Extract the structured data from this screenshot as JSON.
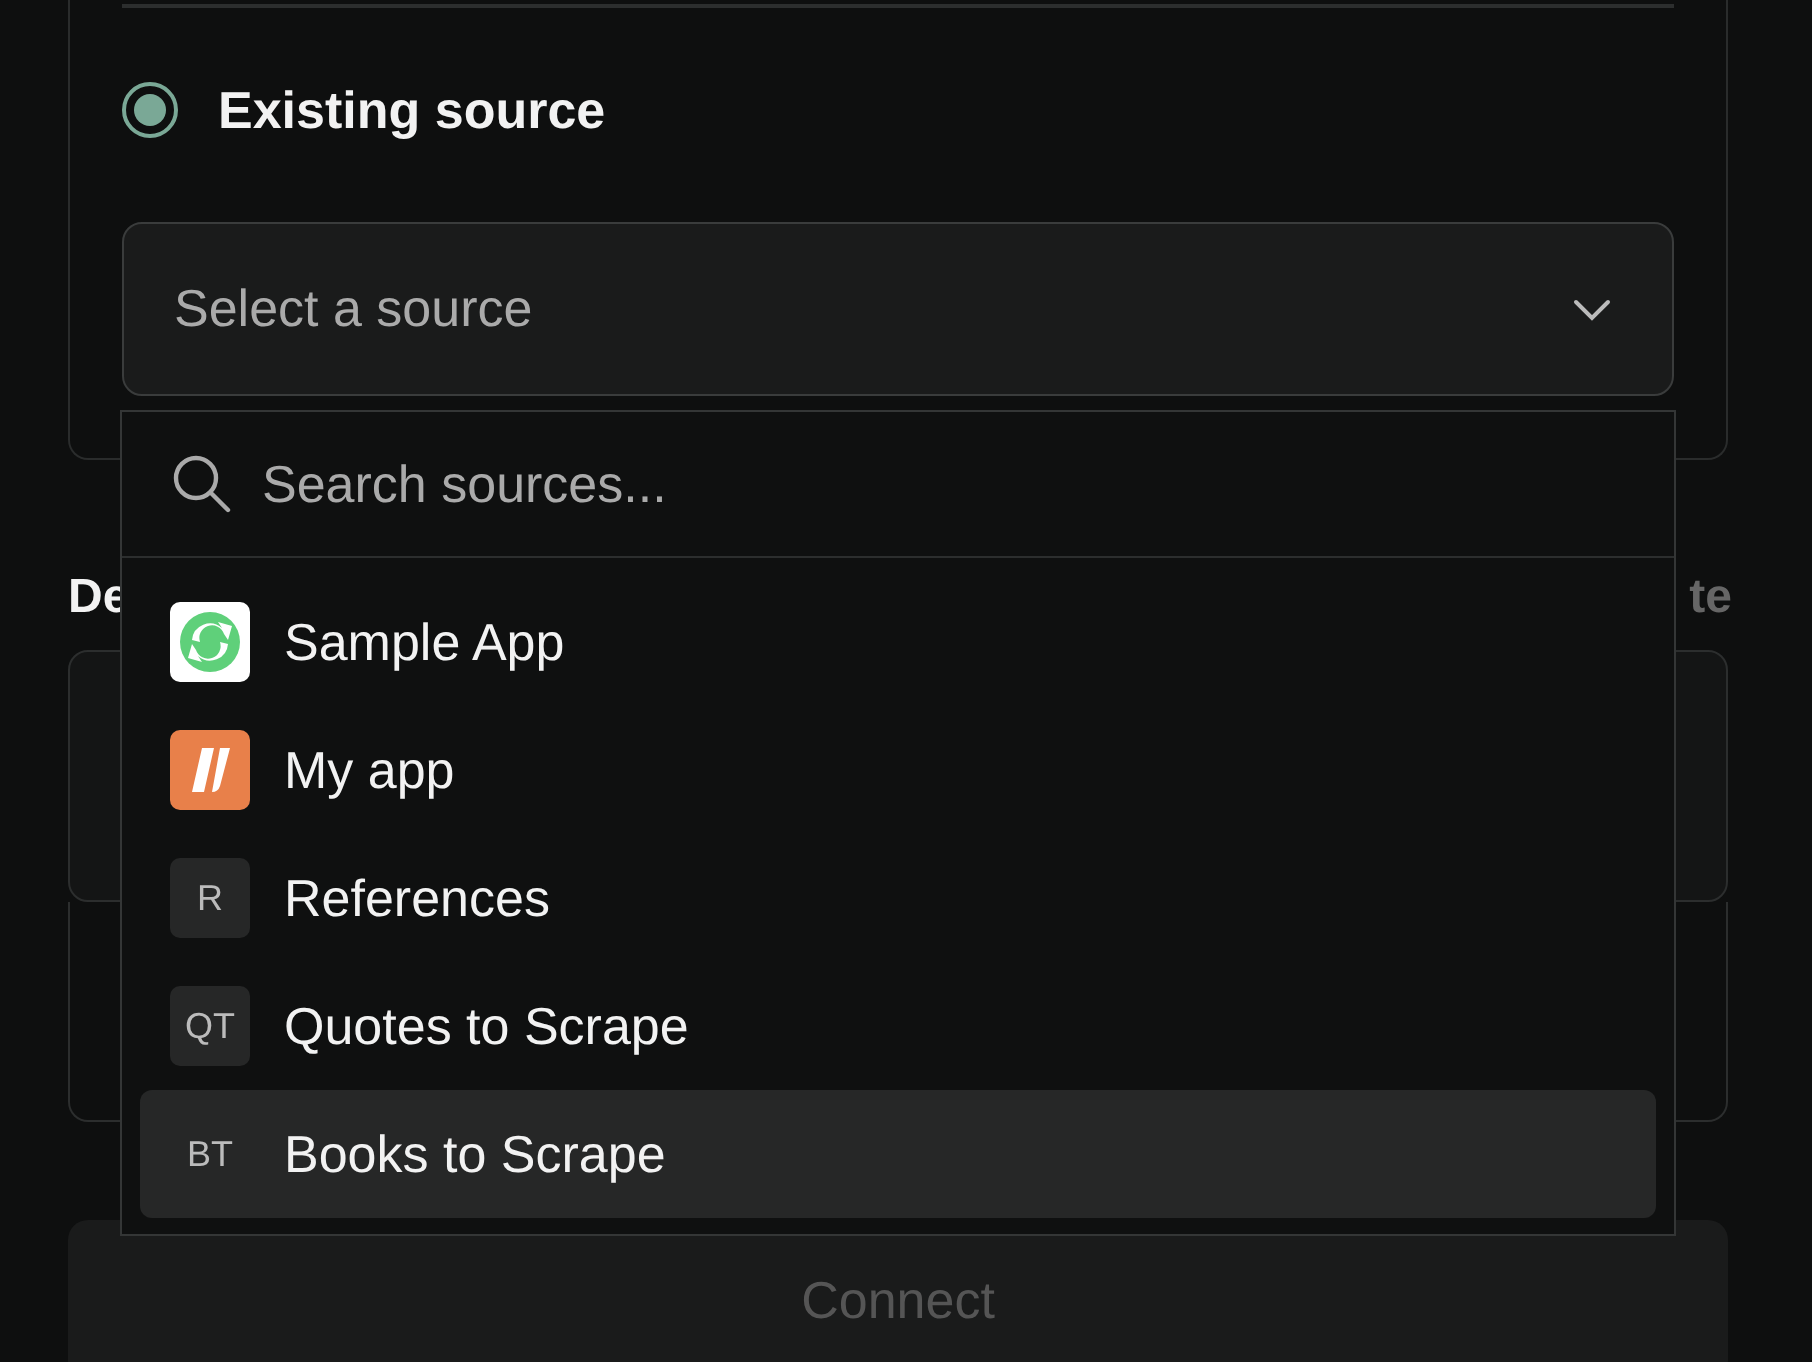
{
  "source_option": {
    "label": "Existing source",
    "checked": true
  },
  "source_select": {
    "placeholder": "Select a source"
  },
  "section_label_left": "De",
  "section_label_right": "te",
  "dropdown": {
    "search": {
      "placeholder": "Search sources..."
    },
    "items": [
      {
        "label": "Sample App",
        "kind": "logo-arrows",
        "selected": false
      },
      {
        "label": "My app",
        "kind": "logo-slashes",
        "selected": false
      },
      {
        "label": "References",
        "kind": "initials",
        "initials": "R",
        "selected": false
      },
      {
        "label": "Quotes to Scrape",
        "kind": "initials",
        "initials": "QT",
        "selected": false
      },
      {
        "label": "Books to Scrape",
        "kind": "initials",
        "initials": "BT",
        "selected": true
      }
    ]
  },
  "connect_button": {
    "label": "Connect",
    "disabled": true
  }
}
